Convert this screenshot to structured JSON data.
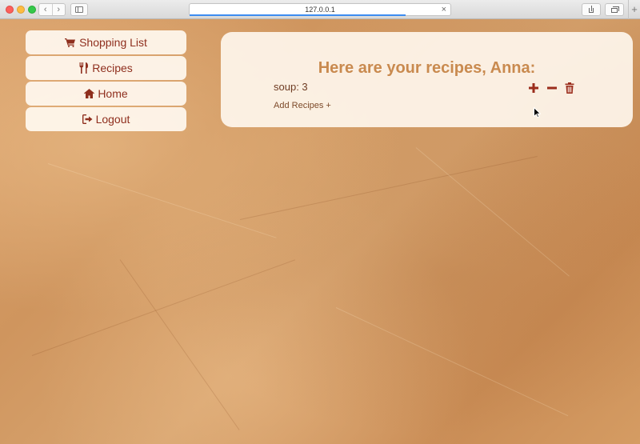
{
  "browser": {
    "url": "127.0.0.1",
    "back_glyph": "‹",
    "forward_glyph": "›",
    "close_glyph": "×",
    "newtab_glyph": "+"
  },
  "nav": {
    "items": [
      {
        "label": "Shopping List",
        "icon": "cart-icon"
      },
      {
        "label": "Recipes",
        "icon": "utensils-icon"
      },
      {
        "label": "Home",
        "icon": "home-icon"
      },
      {
        "label": "Logout",
        "icon": "sign-out-icon"
      }
    ]
  },
  "main": {
    "title": "Here are your recipes, Anna:",
    "recipes": [
      {
        "text": "soup: 3"
      }
    ],
    "add_label": "Add Recipes +"
  },
  "colors": {
    "accent": "#8f2f1e",
    "title": "#c98a4f",
    "panel_bg": "#fff8f0"
  }
}
